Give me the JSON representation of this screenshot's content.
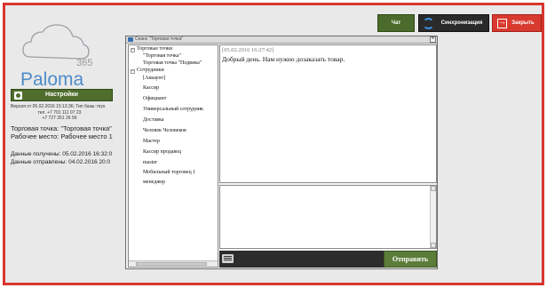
{
  "brand": {
    "name": "Paloma",
    "sub": "365"
  },
  "settings_label": "Настройки",
  "version_lines": [
    "Версия от 05.02.2016 15:13:36; Тип базы: mys",
    "тел. +7 701 111 07 23",
    "+7 727 351 26 56"
  ],
  "store_label": "Торговая точка: \"Торговая точка\"",
  "workplace_label": "Рабочее место: Рабочее место 1",
  "received_label": "Данные получены: 05.02.2016 16:32:0",
  "sent_label": "Данные отправлены: 04.02.2016 20:0",
  "buttons": {
    "chat": "Чат",
    "sync": "Синхронизация",
    "close": "Закрыть"
  },
  "chat_window": {
    "title": "Сеанс \"Торговая точка\"",
    "tree": {
      "group1": "Торговые точки",
      "stores": [
        "\"Торговая точка\"",
        "Торговая точка \"Подвика\""
      ],
      "group2": "Сотрудники",
      "staff": [
        "[Аккаунт]",
        "Кассир",
        "Официант",
        "Универсальный сотрудник",
        "Доставка",
        "Человек Человеков",
        "Мастер",
        "Кассир продавец",
        "master",
        "Мобильный торговец 1",
        "менеджер"
      ]
    },
    "message": {
      "time": "[05.02.2016 16:27:42]",
      "text": "Добрый день. Нам нужно дозаказать товар."
    },
    "send_label": "Отправить"
  },
  "colors": {
    "frame": "#d9362e",
    "green": "#5c7d3a",
    "red": "#d93a2f",
    "dark": "#2c2c2c"
  }
}
